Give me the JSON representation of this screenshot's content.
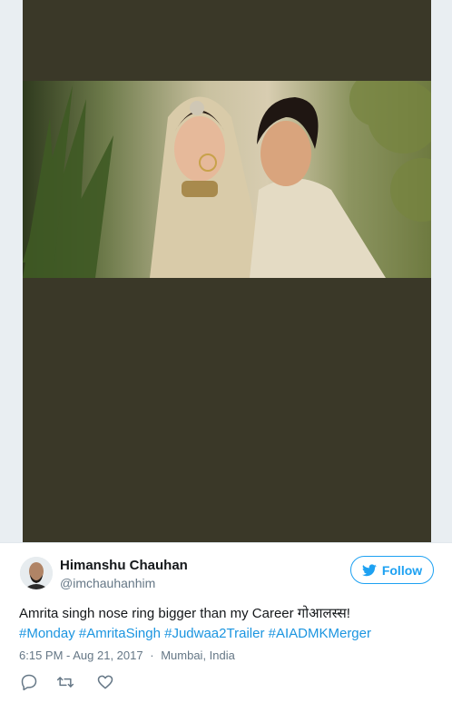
{
  "tweet": {
    "author": {
      "display_name": "Himanshu Chauhan",
      "handle": "@imchauhanhim"
    },
    "follow_label": "Follow",
    "text": "Amrita singh nose ring bigger than my Career गोआलस्स!",
    "hashtags": [
      "#Monday",
      "#AmritaSingh",
      "#Judwaa2Trailer",
      "#AIADMKMerger"
    ],
    "time": "6:15 PM - Aug 21, 2017",
    "separator": "·",
    "location": "Mumbai, India",
    "actions": [
      "reply-icon",
      "retweet-icon",
      "like-icon"
    ]
  },
  "colors": {
    "accent": "#1da1f2",
    "hashtag": "#1b95e0",
    "muted": "#657786",
    "media_background": "#3a3828"
  }
}
